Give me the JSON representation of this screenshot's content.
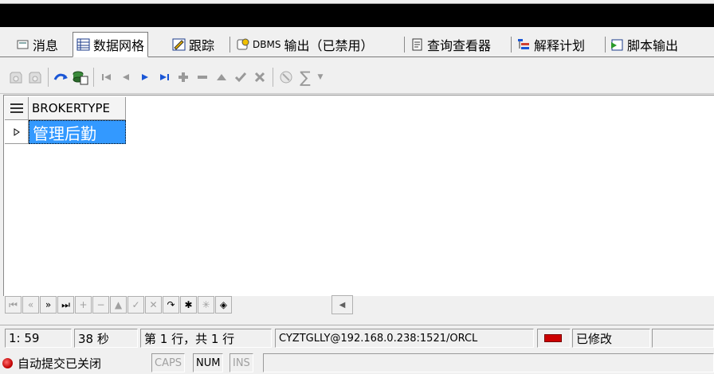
{
  "tabs": [
    {
      "label": "消息",
      "icon": "message-icon"
    },
    {
      "label": "数据网格",
      "icon": "data-grid-icon",
      "active": true
    },
    {
      "label": "跟踪",
      "icon": "trace-icon"
    },
    {
      "label_prefix": "DBMS",
      "label": " 输出（已禁用）",
      "icon": "dbms-output-icon"
    },
    {
      "label": "查询查看器",
      "icon": "query-viewer-icon"
    },
    {
      "label": "解释计划",
      "icon": "explain-plan-icon"
    },
    {
      "label": "脚本输出",
      "icon": "script-output-icon"
    }
  ],
  "toolbar": {
    "icons": [
      "save-icon",
      "save-all-icon",
      "refresh-icon",
      "export-icon",
      "first-record-icon",
      "prev-record-icon",
      "next-record-icon",
      "last-record-icon",
      "insert-record-icon",
      "delete-record-icon",
      "edit-record-icon",
      "post-record-icon",
      "cancel-record-icon",
      "filter-icon",
      "sum-icon",
      "dropdown-icon"
    ],
    "sum_symbol": "∑"
  },
  "grid": {
    "columns": [
      "BROKERTYPE"
    ],
    "rows": [
      [
        "管理后勤"
      ]
    ]
  },
  "status": {
    "cursor_position": "1:  59",
    "elapsed": "38 秒",
    "row_info": "第 1 行，共 1 行",
    "connection": "CYZTGLLY@192.168.0.238:1521/ORCL",
    "modified": "已修改",
    "auto_commit": "自动提交已关闭",
    "caps": "CAPS",
    "num": "NUM",
    "ins": "INS"
  },
  "colors": {
    "selection": "#3399ff",
    "indicator_red": "#cc0000"
  }
}
